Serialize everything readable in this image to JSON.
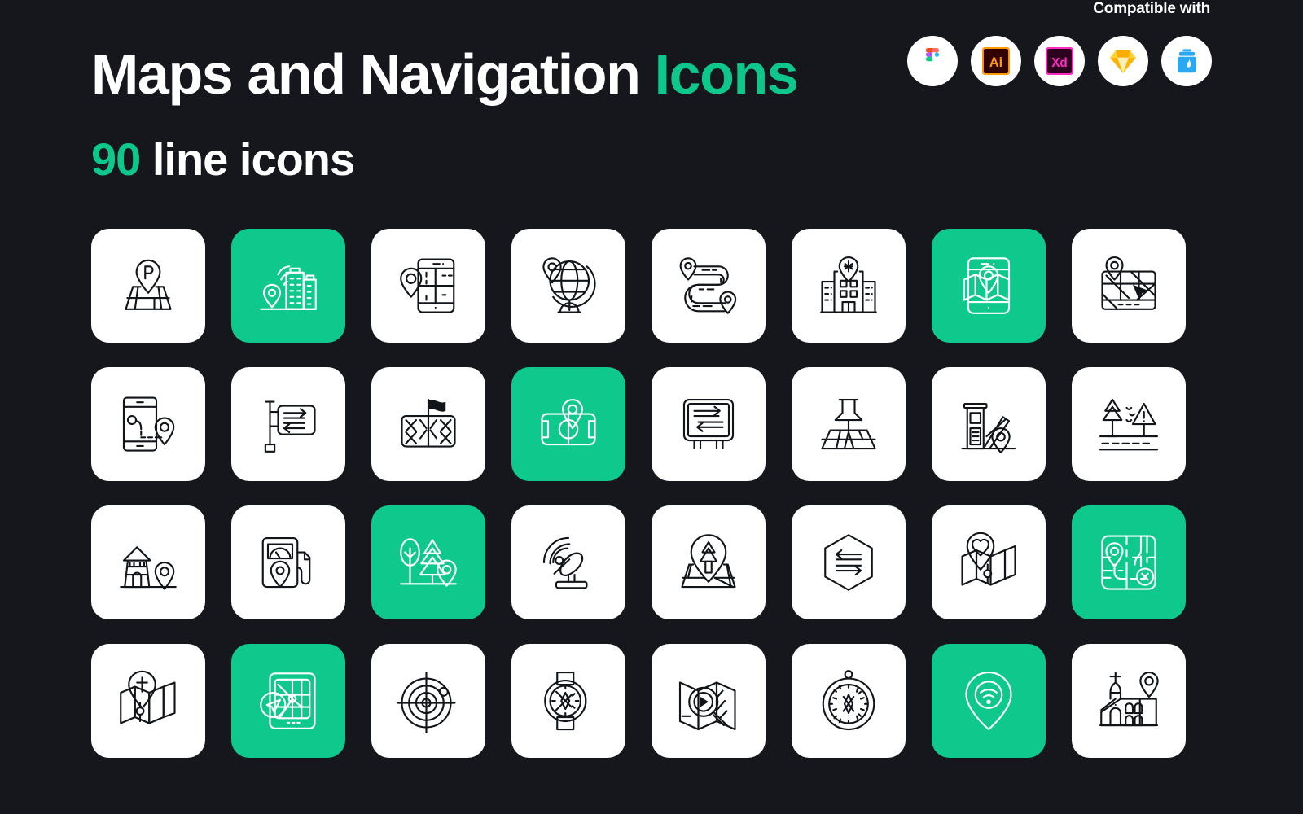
{
  "header": {
    "title_main": "Maps and Navigation",
    "title_accent": "Icons",
    "subtitle_count": "90",
    "subtitle_text": "line icons"
  },
  "compatible": {
    "label": "Compatible with",
    "badges": [
      {
        "name": "figma-logo",
        "title": "Figma"
      },
      {
        "name": "adobe-illustrator-logo",
        "title": "Ai"
      },
      {
        "name": "adobe-xd-logo",
        "title": "Xd"
      },
      {
        "name": "sketch-logo",
        "title": "Sketch"
      },
      {
        "name": "iconjar-logo",
        "title": "IconJar"
      }
    ]
  },
  "colors": {
    "background": "#15171c",
    "accent_green": "#0ec98b",
    "card_white": "#ffffff",
    "stroke_dark": "#111418"
  },
  "grid": {
    "columns": 8,
    "rows": 4,
    "icons": [
      {
        "name": "parking-map-pin-icon",
        "green": false
      },
      {
        "name": "city-buildings-signal-pin-icon",
        "green": true
      },
      {
        "name": "mobile-map-pin-icon",
        "green": false
      },
      {
        "name": "globe-pin-icon",
        "green": false
      },
      {
        "name": "route-path-pins-icon",
        "green": false
      },
      {
        "name": "hospital-pin-icon",
        "green": false
      },
      {
        "name": "mobile-folded-map-pin-icon",
        "green": true
      },
      {
        "name": "browser-map-cursor-icon",
        "green": false
      },
      {
        "name": "mobile-route-tracking-icon",
        "green": false
      },
      {
        "name": "signpost-two-way-arrows-icon",
        "green": false
      },
      {
        "name": "map-flag-icon",
        "green": false
      },
      {
        "name": "stadium-map-pin-icon",
        "green": true
      },
      {
        "name": "direction-board-arrows-icon",
        "green": false
      },
      {
        "name": "pushpin-map-icon",
        "green": false
      },
      {
        "name": "toll-booth-barrier-pin-icon",
        "green": false
      },
      {
        "name": "forest-road-warning-icon",
        "green": false
      },
      {
        "name": "lighthouse-pin-icon",
        "green": false
      },
      {
        "name": "gas-station-pin-icon",
        "green": false
      },
      {
        "name": "park-trees-pin-icon",
        "green": true
      },
      {
        "name": "satellite-dish-icon",
        "green": false
      },
      {
        "name": "tree-pin-map-icon",
        "green": false
      },
      {
        "name": "hexagon-two-way-arrows-icon",
        "green": false
      },
      {
        "name": "favorite-heart-pin-map-icon",
        "green": false
      },
      {
        "name": "route-destination-map-icon",
        "green": true
      },
      {
        "name": "church-pin-map-icon",
        "green": false
      },
      {
        "name": "tablet-gps-navigation-icon",
        "green": true
      },
      {
        "name": "radar-target-icon",
        "green": false
      },
      {
        "name": "smartwatch-compass-icon",
        "green": false
      },
      {
        "name": "map-search-navigation-icon",
        "green": false
      },
      {
        "name": "compass-icon",
        "green": false
      },
      {
        "name": "wifi-location-pin-icon",
        "green": true
      },
      {
        "name": "church-building-pin-icon",
        "green": false
      }
    ]
  }
}
